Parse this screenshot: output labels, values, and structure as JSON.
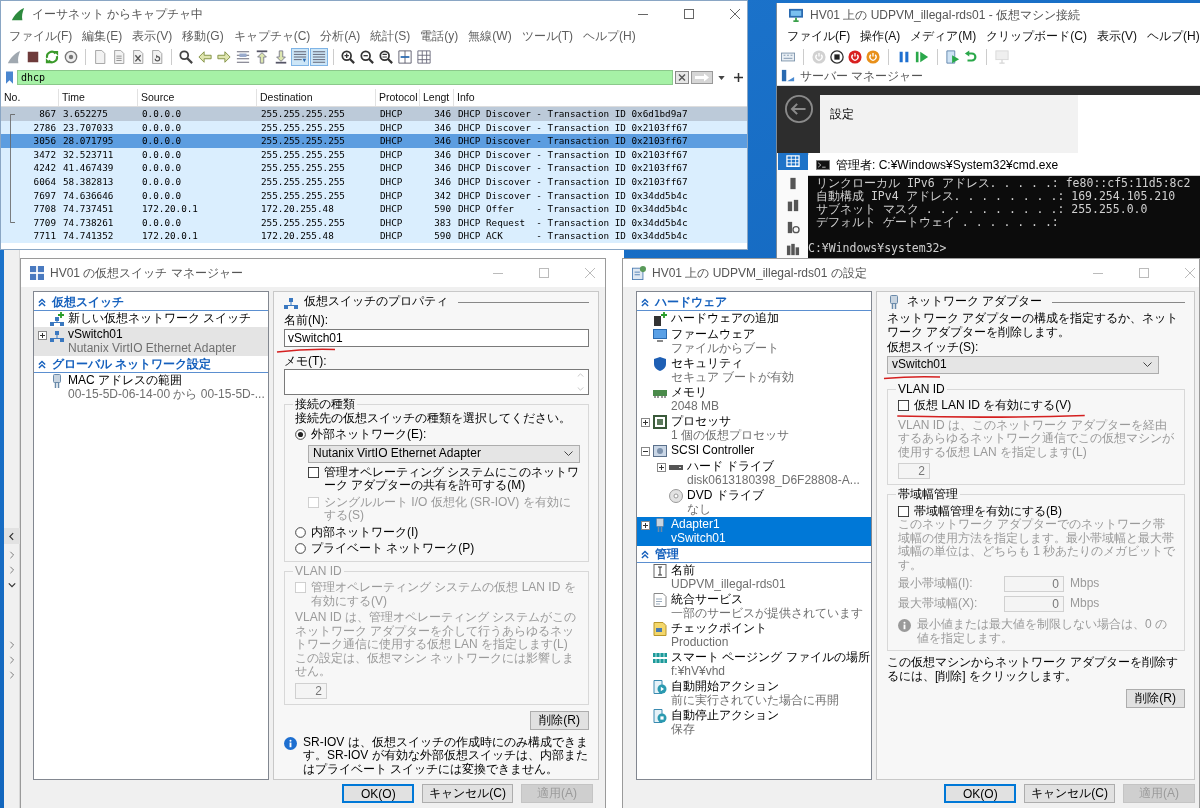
{
  "wireshark": {
    "title": "イーサネット からキャプチャ中",
    "menu": [
      "ファイル(F)",
      "編集(E)",
      "表示(V)",
      "移動(G)",
      "キャプチャ(C)",
      "分析(A)",
      "統計(S)",
      "電話(y)",
      "無線(W)",
      "ツール(T)",
      "ヘルプ(H)"
    ],
    "toolbar": [
      {
        "on": false
      },
      {
        "on": false
      },
      {
        "on": false
      },
      {
        "on": false
      },
      {
        "on": false
      },
      {
        "on": false
      },
      {
        "on": false
      },
      {
        "on": false
      },
      {
        "on": false
      },
      {
        "on": false
      },
      {
        "on": false
      },
      {
        "on": false
      },
      {
        "on": false
      },
      {
        "on": false
      },
      {
        "on": true
      },
      {
        "on": true
      },
      {
        "on": false
      },
      {
        "on": false
      },
      {
        "on": false
      },
      {
        "on": false
      },
      {
        "on": false
      }
    ],
    "filter": {
      "value": "dhcp"
    },
    "columns": [
      "No.",
      "Time",
      "Source",
      "Destination",
      "Protocol",
      "Lengt",
      "Info"
    ],
    "rows": [
      {
        "no": "867",
        "time": "3.652275",
        "source": "0.0.0.0",
        "destination": "255.255.255.255",
        "protocol": "DHCP",
        "length": "346",
        "info": "DHCP Discover - Transaction ID 0x6d1bd9a7",
        "hovered": true,
        "selected": false
      },
      {
        "no": "2786",
        "time": "23.707033",
        "source": "0.0.0.0",
        "destination": "255.255.255.255",
        "protocol": "DHCP",
        "length": "346",
        "info": "DHCP Discover - Transaction ID 0x2103ff67",
        "hovered": false,
        "selected": false
      },
      {
        "no": "3056",
        "time": "28.071795",
        "source": "0.0.0.0",
        "destination": "255.255.255.255",
        "protocol": "DHCP",
        "length": "346",
        "info": "DHCP Discover - Transaction ID 0x2103ff67",
        "hovered": false,
        "selected": true
      },
      {
        "no": "3472",
        "time": "32.523711",
        "source": "0.0.0.0",
        "destination": "255.255.255.255",
        "protocol": "DHCP",
        "length": "346",
        "info": "DHCP Discover - Transaction ID 0x2103ff67",
        "hovered": false,
        "selected": false
      },
      {
        "no": "4242",
        "time": "41.467439",
        "source": "0.0.0.0",
        "destination": "255.255.255.255",
        "protocol": "DHCP",
        "length": "346",
        "info": "DHCP Discover - Transaction ID 0x2103ff67",
        "hovered": false,
        "selected": false
      },
      {
        "no": "6064",
        "time": "58.382813",
        "source": "0.0.0.0",
        "destination": "255.255.255.255",
        "protocol": "DHCP",
        "length": "346",
        "info": "DHCP Discover - Transaction ID 0x2103ff67",
        "hovered": false,
        "selected": false
      },
      {
        "no": "7697",
        "time": "74.636646",
        "source": "0.0.0.0",
        "destination": "255.255.255.255",
        "protocol": "DHCP",
        "length": "342",
        "info": "DHCP Discover - Transaction ID 0x34dd5b4c",
        "hovered": false,
        "selected": false
      },
      {
        "no": "7708",
        "time": "74.737451",
        "source": "172.20.0.1",
        "destination": "172.20.255.48",
        "protocol": "DHCP",
        "length": "590",
        "info": "DHCP Offer    - Transaction ID 0x34dd5b4c",
        "hovered": false,
        "selected": false
      },
      {
        "no": "7709",
        "time": "74.738261",
        "source": "0.0.0.0",
        "destination": "255.255.255.255",
        "protocol": "DHCP",
        "length": "383",
        "info": "DHCP Request  - Transaction ID 0x34dd5b4c",
        "hovered": false,
        "selected": false
      },
      {
        "no": "7711",
        "time": "74.741352",
        "source": "172.20.0.1",
        "destination": "172.20.255.48",
        "protocol": "DHCP",
        "length": "590",
        "info": "DHCP ACK      - Transaction ID 0x34dd5b4c",
        "hovered": false,
        "selected": false
      }
    ]
  },
  "vm_connection": {
    "title": "HV01 上の UDPVM_illegal-rds01 - 仮想マシン接続",
    "menu": [
      "ファイル(F)",
      "操作(A)",
      "メディア(M)",
      "クリップボード(C)",
      "表示(V)",
      "ヘルプ(H)"
    ],
    "toolbar": [
      {
        "disabled": false
      },
      {
        "disabled": true
      },
      {
        "disabled": false
      },
      {
        "disabled": false
      },
      {
        "disabled": false
      },
      {
        "disabled": false
      },
      {
        "disabled": false
      },
      {
        "disabled": false
      },
      {
        "disabled": false
      },
      {
        "disabled": true
      }
    ],
    "server_manager": {
      "title": "サーバー マネージャー",
      "panel_title": "設定",
      "sidebar": [
        {
          "selected": true
        },
        {
          "selected": false
        },
        {
          "selected": false
        },
        {
          "selected": false
        },
        {
          "selected": false
        }
      ]
    }
  },
  "console": {
    "title": "管理者: C:¥Windows¥System32¥cmd.exe",
    "lines": [
      "リンクローカル IPv6 アドレス. . . . .: fe80::cf5:11d5:8c2",
      "自動構成 IPv4 アドレス. . . . . . . .: 169.254.105.210",
      "サブネット マスク . . . . . . . . . .: 255.255.0.0",
      "デフォルト ゲートウェイ . . . . . . .:"
    ],
    "prompt": "C:¥Windows¥system32>"
  },
  "background_window": {
    "toggle_groups": [
      [
        {
          "expanded": false
        },
        {
          "expanded": false
        },
        {
          "expanded": true
        }
      ],
      [
        {
          "expanded": false
        },
        {
          "expanded": false
        },
        {
          "expanded": false
        }
      ]
    ]
  },
  "switch_manager": {
    "title": "HV01 の仮想スイッチ マネージャー",
    "tree": [
      {
        "title": "仮想スイッチ",
        "expanded": true,
        "items": [
          {
            "kind": "new-switch",
            "label": "新しい仮想ネットワーク スイッチ",
            "selected": false
          },
          {
            "kind": "switch",
            "label": "vSwitch01",
            "detail": "Nutanix VirtIO Ethernet Adapter",
            "expanded": false,
            "selected": true
          }
        ]
      },
      {
        "title": "グローバル ネットワーク設定",
        "expanded": true,
        "items": [
          {
            "kind": "mac-range",
            "label": "MAC アドレスの範囲",
            "detail": "00-15-5D-06-14-00 から 00-15-5D-...",
            "selected": false
          }
        ]
      }
    ],
    "properties": {
      "title": "仮想スイッチのプロパティ",
      "name": {
        "label": "名前(N):",
        "value": "vSwitch01",
        "annotated": true
      },
      "notes": {
        "label": "メモ(T):"
      },
      "connection": {
        "title": "接続の種類",
        "prompt": "接続先の仮想スイッチの種類を選択してください。",
        "options": [
          {
            "label": "外部ネットワーク(E):",
            "selected": true,
            "adapter": "Nutanix VirtIO Ethernet Adapter",
            "checkboxes": [
              {
                "label": "管理オペレーティング システムにこのネットワーク アダプターの共有を許可する(M)",
                "checked": false,
                "disabled": false
              },
              {
                "label": "シングルルート I/O 仮想化 (SR-IOV) を有効にする(S)",
                "checked": false,
                "disabled": true
              }
            ]
          },
          {
            "label": "内部ネットワーク(I)",
            "selected": false
          },
          {
            "label": "プライベート ネットワーク(P)",
            "selected": false
          }
        ]
      },
      "vlan": {
        "title": "VLAN ID",
        "disabled": true,
        "checkbox": {
          "label": "管理オペレーティング システムの仮想 LAN ID を有効にする(V)",
          "checked": false
        },
        "description": [
          "VLAN ID は、管理オペレーティング システムがこのネットワーク アダプターを介して行うあらゆるネットワーク通信に使用する仮想 LAN を指定します(L)",
          "この設定は、仮想マシン ネットワークには影響しません。"
        ],
        "value": "2"
      },
      "remove_button": "削除(R)",
      "info": "SR-IOV は、仮想スイッチの作成時にのみ構成できます。SR-IOV が有効な外部仮想スイッチは、内部またはプライベート スイッチには変換できません。"
    },
    "buttons": [
      {
        "label": "OK(O)",
        "default": true,
        "disabled": false
      },
      {
        "label": "キャンセル(C)",
        "default": false,
        "disabled": false
      },
      {
        "label": "適用(A)",
        "default": false,
        "disabled": true
      }
    ]
  },
  "vm_settings": {
    "title": "HV01 上の UDPVM_illegal-rds01 の設定",
    "tree": [
      {
        "title": "ハードウェア",
        "expanded": true,
        "items": [
          {
            "kind": "add-hardware",
            "label": "ハードウェアの追加",
            "selected": false
          },
          {
            "kind": "firmware",
            "label": "ファームウェア",
            "detail": "ファイルからブート",
            "selected": false
          },
          {
            "kind": "security",
            "label": "セキュリティ",
            "detail": "セキュア ブートが有効",
            "selected": false
          },
          {
            "kind": "memory",
            "label": "メモリ",
            "detail": "2048 MB",
            "selected": false
          },
          {
            "kind": "processor",
            "label": "プロセッサ",
            "detail": "1 個の仮想プロセッサ",
            "expanded": false,
            "selected": false
          },
          {
            "kind": "controller",
            "label": "SCSI Controller",
            "expanded": true,
            "selected": false,
            "children": [
              {
                "kind": "drive",
                "label": "ハード ドライブ",
                "detail": "disk0613180398_D6F28808-A...",
                "expanded": false,
                "selected": false
              },
              {
                "kind": "dvd",
                "label": "DVD ドライブ",
                "detail": "なし",
                "selected": false
              }
            ]
          },
          {
            "kind": "adapter",
            "label": "Adapter1",
            "detail": "vSwitch01",
            "expanded": false,
            "selected": true
          }
        ]
      },
      {
        "title": "管理",
        "expanded": true,
        "items": [
          {
            "kind": "name",
            "label": "名前",
            "detail": "UDPVM_illegal-rds01",
            "selected": false
          },
          {
            "kind": "services",
            "label": "統合サービス",
            "detail": "一部のサービスが提供されています",
            "selected": false
          },
          {
            "kind": "checkpoint",
            "label": "チェックポイント",
            "detail": "Production",
            "selected": false
          },
          {
            "kind": "paging",
            "label": "スマート ページング ファイルの場所",
            "detail": "f:¥hV¥vhd",
            "selected": false
          },
          {
            "kind": "autostart",
            "label": "自動開始アクション",
            "detail": "前に実行されていた場合に再開",
            "selected": false
          },
          {
            "kind": "autostop",
            "label": "自動停止アクション",
            "detail": "保存",
            "selected": false
          }
        ]
      }
    ],
    "adapter": {
      "title": "ネットワーク アダプター",
      "description": "ネットワーク アダプターの構成を指定するか、ネットワーク アダプターを削除します。",
      "switch": {
        "label": "仮想スイッチ(S):",
        "value": "vSwitch01",
        "annotated": true
      },
      "vlan": {
        "title": "VLAN ID",
        "checkbox": {
          "label": "仮想 LAN ID を有効にする(V)",
          "checked": false,
          "annotated": true
        },
        "description": "VLAN ID は、このネットワーク アダプターを経由するあらゆるネットワーク通信でこの仮想マシンが使用する仮想 LAN を指定します(L)",
        "value": "2"
      },
      "bandwidth": {
        "title": "帯域幅管理",
        "checkbox": {
          "label": "帯域幅管理を有効にする(B)",
          "checked": false
        },
        "description": "このネットワーク アダプターでのネットワーク帯域幅の使用方法を指定します。最小帯域幅と最大帯域幅の単位は、どちらも 1 秒あたりのメガビットです。",
        "fields": [
          {
            "label": "最小帯域幅(I):",
            "value": "0",
            "unit": "Mbps"
          },
          {
            "label": "最大帯域幅(X):",
            "value": "0",
            "unit": "Mbps"
          }
        ],
        "info": "最小値または最大値を制限しない場合は、0 の値を指定します。"
      },
      "remove_hint": "この仮想マシンからネットワーク アダプターを削除するには、[削除] をクリックします。",
      "remove_button": "削除(R)"
    },
    "buttons": [
      {
        "label": "OK(O)",
        "default": true,
        "disabled": false
      },
      {
        "label": "キャンセル(C)",
        "default": false,
        "disabled": false
      },
      {
        "label": "適用(A)",
        "default": false,
        "disabled": true
      }
    ]
  }
}
